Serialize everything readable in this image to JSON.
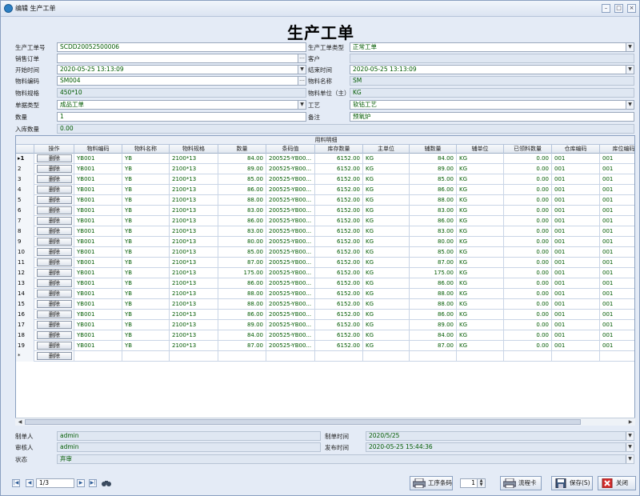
{
  "window": {
    "title": "编辑 生产工单"
  },
  "form": {
    "title": "生产工单",
    "work_order_no": {
      "label": "生产工单号",
      "value": "SCDD20052500006"
    },
    "work_order_type": {
      "label": "生产工单类型",
      "value": "正常工单"
    },
    "sales_order": {
      "label": "销售订单",
      "value": ""
    },
    "customer": {
      "label": "客户",
      "value": ""
    },
    "start_time": {
      "label": "开始时间",
      "value": "2020-05-25 13:13:09"
    },
    "end_time": {
      "label": "结束时间",
      "value": "2020-05-25 13:13:09"
    },
    "material_code": {
      "label": "物料编码",
      "value": "SM004"
    },
    "material_name": {
      "label": "物料名称",
      "value": "SM"
    },
    "material_spec": {
      "label": "物料规格",
      "value": "450*10"
    },
    "material_unit": {
      "label": "物料单位（主）",
      "value": "KG"
    },
    "doc_type": {
      "label": "单据类型",
      "value": "成品工单"
    },
    "process": {
      "label": "工艺",
      "value": "软钴工艺"
    },
    "quantity": {
      "label": "数量",
      "value": "1"
    },
    "remark": {
      "label": "备注",
      "value": "预氧炉"
    },
    "stock_in_qty": {
      "label": "入库数量",
      "value": "0.00"
    }
  },
  "grid": {
    "caption": "用料明细",
    "columns": [
      "操作",
      "物料编码",
      "物料名称",
      "物料规格",
      "数量",
      "条码值",
      "库存数量",
      "主单位",
      "辅数量",
      "辅单位",
      "已领料数量",
      "仓库编码",
      "库位编码"
    ],
    "delete_label": "删除",
    "new_row_marker": "*",
    "rows": [
      {
        "n": "1",
        "code": "YB001",
        "name": "YB",
        "spec": "2100*13",
        "qty": "84.00",
        "barcode": "200525-YB00...",
        "stock": "6152.00",
        "unit": "KG",
        "aux_qty": "84.00",
        "aux_unit": "KG",
        "picked": "0.00",
        "wh": "001",
        "loc": "001"
      },
      {
        "n": "2",
        "code": "YB001",
        "name": "YB",
        "spec": "2100*13",
        "qty": "89.00",
        "barcode": "200525-YB00...",
        "stock": "6152.00",
        "unit": "KG",
        "aux_qty": "89.00",
        "aux_unit": "KG",
        "picked": "0.00",
        "wh": "001",
        "loc": "001"
      },
      {
        "n": "3",
        "code": "YB001",
        "name": "YB",
        "spec": "2100*13",
        "qty": "85.00",
        "barcode": "200525-YB00...",
        "stock": "6152.00",
        "unit": "KG",
        "aux_qty": "85.00",
        "aux_unit": "KG",
        "picked": "0.00",
        "wh": "001",
        "loc": "001"
      },
      {
        "n": "4",
        "code": "YB001",
        "name": "YB",
        "spec": "2100*13",
        "qty": "86.00",
        "barcode": "200525-YB00...",
        "stock": "6152.00",
        "unit": "KG",
        "aux_qty": "86.00",
        "aux_unit": "KG",
        "picked": "0.00",
        "wh": "001",
        "loc": "001"
      },
      {
        "n": "5",
        "code": "YB001",
        "name": "YB",
        "spec": "2100*13",
        "qty": "88.00",
        "barcode": "200525-YB00...",
        "stock": "6152.00",
        "unit": "KG",
        "aux_qty": "88.00",
        "aux_unit": "KG",
        "picked": "0.00",
        "wh": "001",
        "loc": "001"
      },
      {
        "n": "6",
        "code": "YB001",
        "name": "YB",
        "spec": "2100*13",
        "qty": "83.00",
        "barcode": "200525-YB00...",
        "stock": "6152.00",
        "unit": "KG",
        "aux_qty": "83.00",
        "aux_unit": "KG",
        "picked": "0.00",
        "wh": "001",
        "loc": "001"
      },
      {
        "n": "7",
        "code": "YB001",
        "name": "YB",
        "spec": "2100*13",
        "qty": "86.00",
        "barcode": "200525-YB00...",
        "stock": "6152.00",
        "unit": "KG",
        "aux_qty": "86.00",
        "aux_unit": "KG",
        "picked": "0.00",
        "wh": "001",
        "loc": "001"
      },
      {
        "n": "8",
        "code": "YB001",
        "name": "YB",
        "spec": "2100*13",
        "qty": "83.00",
        "barcode": "200525-YB00...",
        "stock": "6152.00",
        "unit": "KG",
        "aux_qty": "83.00",
        "aux_unit": "KG",
        "picked": "0.00",
        "wh": "001",
        "loc": "001"
      },
      {
        "n": "9",
        "code": "YB001",
        "name": "YB",
        "spec": "2100*13",
        "qty": "80.00",
        "barcode": "200525-YB00...",
        "stock": "6152.00",
        "unit": "KG",
        "aux_qty": "80.00",
        "aux_unit": "KG",
        "picked": "0.00",
        "wh": "001",
        "loc": "001"
      },
      {
        "n": "10",
        "code": "YB001",
        "name": "YB",
        "spec": "2100*13",
        "qty": "85.00",
        "barcode": "200525-YB00...",
        "stock": "6152.00",
        "unit": "KG",
        "aux_qty": "85.00",
        "aux_unit": "KG",
        "picked": "0.00",
        "wh": "001",
        "loc": "001"
      },
      {
        "n": "11",
        "code": "YB001",
        "name": "YB",
        "spec": "2100*13",
        "qty": "87.00",
        "barcode": "200525-YB00...",
        "stock": "6152.00",
        "unit": "KG",
        "aux_qty": "87.00",
        "aux_unit": "KG",
        "picked": "0.00",
        "wh": "001",
        "loc": "001"
      },
      {
        "n": "12",
        "code": "YB001",
        "name": "YB",
        "spec": "2100*13",
        "qty": "175.00",
        "barcode": "200525-YB00...",
        "stock": "6152.00",
        "unit": "KG",
        "aux_qty": "175.00",
        "aux_unit": "KG",
        "picked": "0.00",
        "wh": "001",
        "loc": "001"
      },
      {
        "n": "13",
        "code": "YB001",
        "name": "YB",
        "spec": "2100*13",
        "qty": "86.00",
        "barcode": "200525-YB00...",
        "stock": "6152.00",
        "unit": "KG",
        "aux_qty": "86.00",
        "aux_unit": "KG",
        "picked": "0.00",
        "wh": "001",
        "loc": "001"
      },
      {
        "n": "14",
        "code": "YB001",
        "name": "YB",
        "spec": "2100*13",
        "qty": "88.00",
        "barcode": "200525-YB00...",
        "stock": "6152.00",
        "unit": "KG",
        "aux_qty": "88.00",
        "aux_unit": "KG",
        "picked": "0.00",
        "wh": "001",
        "loc": "001"
      },
      {
        "n": "15",
        "code": "YB001",
        "name": "YB",
        "spec": "2100*13",
        "qty": "88.00",
        "barcode": "200525-YB00...",
        "stock": "6152.00",
        "unit": "KG",
        "aux_qty": "88.00",
        "aux_unit": "KG",
        "picked": "0.00",
        "wh": "001",
        "loc": "001"
      },
      {
        "n": "16",
        "code": "YB001",
        "name": "YB",
        "spec": "2100*13",
        "qty": "86.00",
        "barcode": "200525-YB00...",
        "stock": "6152.00",
        "unit": "KG",
        "aux_qty": "86.00",
        "aux_unit": "KG",
        "picked": "0.00",
        "wh": "001",
        "loc": "001"
      },
      {
        "n": "17",
        "code": "YB001",
        "name": "YB",
        "spec": "2100*13",
        "qty": "89.00",
        "barcode": "200525-YB00...",
        "stock": "6152.00",
        "unit": "KG",
        "aux_qty": "89.00",
        "aux_unit": "KG",
        "picked": "0.00",
        "wh": "001",
        "loc": "001"
      },
      {
        "n": "18",
        "code": "YB001",
        "name": "YB",
        "spec": "2100*13",
        "qty": "84.00",
        "barcode": "200525-YB00...",
        "stock": "6152.00",
        "unit": "KG",
        "aux_qty": "84.00",
        "aux_unit": "KG",
        "picked": "0.00",
        "wh": "001",
        "loc": "001"
      },
      {
        "n": "19",
        "code": "YB001",
        "name": "YB",
        "spec": "2100*13",
        "qty": "87.00",
        "barcode": "200525-YB00...",
        "stock": "6152.00",
        "unit": "KG",
        "aux_qty": "87.00",
        "aux_unit": "KG",
        "picked": "0.00",
        "wh": "001",
        "loc": "001"
      }
    ]
  },
  "footer": {
    "creator": {
      "label": "制单人",
      "value": "admin"
    },
    "created_time": {
      "label": "制单时间",
      "value": "2020/5/25"
    },
    "reviewer": {
      "label": "审核人",
      "value": "admin"
    },
    "published_time": {
      "label": "发布时间",
      "value": "2020-05-25 15:44:36"
    },
    "status": {
      "label": "状态",
      "value": "弃审"
    }
  },
  "toolbar": {
    "page": "1/3",
    "process_barcode": "工序条码",
    "copies": "1",
    "flow_card": "流程卡",
    "save": "保存(S)",
    "close": "关闭"
  },
  "colors": {
    "accent": "#2f5e99",
    "value_text": "#005a00",
    "readonly_bg": "#dfe7f2"
  }
}
